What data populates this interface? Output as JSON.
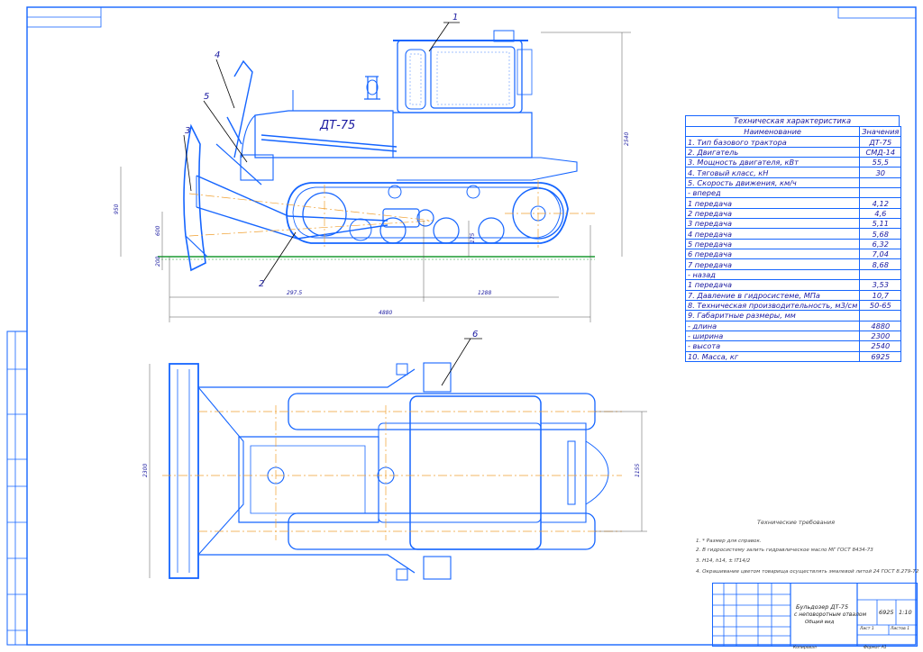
{
  "drawing": {
    "part_labels": [
      "1",
      "2",
      "3",
      "4",
      "5",
      "6"
    ],
    "dimensions": {
      "height_total": "2540",
      "blade_height": "950",
      "h_600": "600",
      "h_200": "200",
      "len_2975": "297.5",
      "len_1288": "1288",
      "len_4880": "4880",
      "track_h": "175",
      "width_2300": "2300",
      "width_1155": "1155"
    },
    "tractor_label": "ДТ-75"
  },
  "spec_table": {
    "title": "Техническая характеристика",
    "header": {
      "name": "Наименование",
      "value": "Значения"
    },
    "rows": [
      {
        "name": "1. Тип базового трактора",
        "value": "ДТ-75"
      },
      {
        "name": "2. Двигатель",
        "value": "СМД-14"
      },
      {
        "name": "3. Мощность двигателя, кВт",
        "value": "55,5"
      },
      {
        "name": "4. Тяговый класс, кН",
        "value": "30"
      },
      {
        "name": "5. Скорость движения, км/ч",
        "value": ""
      },
      {
        "name": "- вперед",
        "value": ""
      },
      {
        "name": "1 передача",
        "value": "4,12"
      },
      {
        "name": "2 передача",
        "value": "4,6"
      },
      {
        "name": "3 передача",
        "value": "5,11"
      },
      {
        "name": "4 передача",
        "value": "5,68"
      },
      {
        "name": "5 передача",
        "value": "6,32"
      },
      {
        "name": "6 передача",
        "value": "7,04"
      },
      {
        "name": "7 передача",
        "value": "8,68"
      },
      {
        "name": "- назад",
        "value": ""
      },
      {
        "name": "1 передача",
        "value": "3,53"
      },
      {
        "name": "7. Давление в гидросистеме, МПа",
        "value": "10,7"
      },
      {
        "name": "8. Техническая производительность, м3/см",
        "value": "50-65"
      },
      {
        "name": "9. Габаритные размеры, мм",
        "value": ""
      },
      {
        "name": "- длина",
        "value": "4880"
      },
      {
        "name": "- ширина",
        "value": "2300"
      },
      {
        "name": "- высота",
        "value": "2540"
      },
      {
        "name": "10. Масса, кг",
        "value": "6925"
      }
    ]
  },
  "notes": {
    "title": "Технические требования",
    "items": [
      "1. * Размер для справок.",
      "2. В гидросистему залить гидравлическое масло МГ ГОСТ 8434-73",
      "3. Н14, h14, ± IT14/2",
      "4. Окрашивание цветом товарища осуществлять эмалевой литой 24 ГОСТ 8.279-72"
    ]
  },
  "title_block": {
    "name_line1": "Бульдозер ДТ-75",
    "name_line2": "с неповоротным отвалом",
    "name_line3": "Общий вид",
    "mass": "6925",
    "scale": "1:10",
    "sheet": "Лист 1",
    "sheets": "Листов 1",
    "copied": "Копировал",
    "format": "Формат А1"
  }
}
